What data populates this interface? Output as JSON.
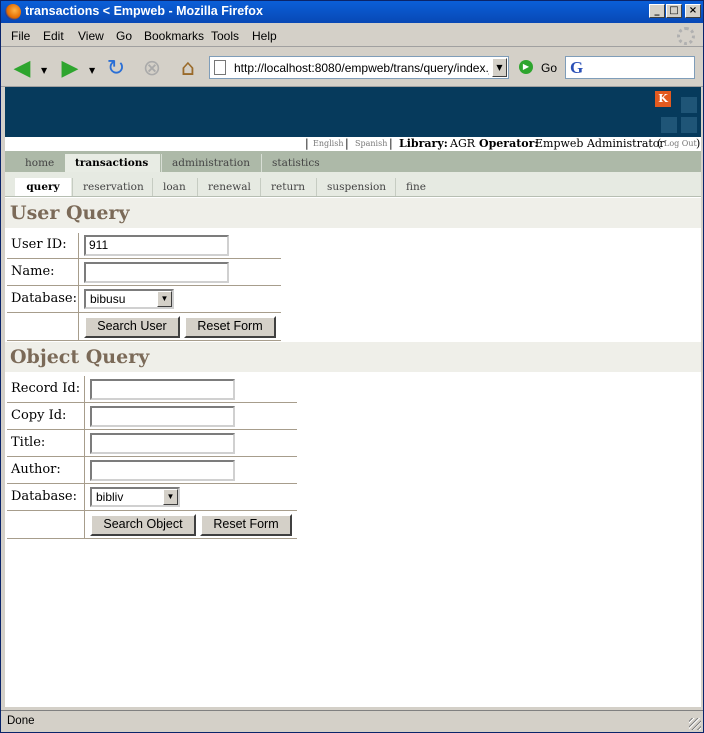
{
  "window": {
    "title": "transactions < Empweb - Mozilla Firefox"
  },
  "menu": {
    "items": [
      "File",
      "Edit",
      "View",
      "Go",
      "Bookmarks",
      "Tools",
      "Help"
    ]
  },
  "navbar": {
    "url": "http://localhost:8080/empweb/trans/query/index.jsp",
    "go_label": "Go"
  },
  "header": {
    "lang_english": "English",
    "lang_spanish": "Spanish",
    "library_label": "Library:",
    "library_value": "AGR",
    "operator_label": "Operator:",
    "operator_value": "Empweb Administrator",
    "logout": "Log Out",
    "logo_letter": "K"
  },
  "tabs": [
    "home",
    "transactions",
    "administration",
    "statistics"
  ],
  "subtabs": [
    "query",
    "reservation",
    "loan",
    "renewal",
    "return",
    "suspension",
    "fine"
  ],
  "user_query": {
    "title": "User Query",
    "userid_label": "User ID:",
    "userid_value": "911",
    "name_label": "Name:",
    "name_value": "",
    "database_label": "Database:",
    "database_value": "bibusu",
    "search_button": "Search User",
    "reset_button": "Reset Form"
  },
  "object_query": {
    "title": "Object Query",
    "recordid_label": "Record Id:",
    "recordid_value": "",
    "copyid_label": "Copy Id:",
    "copyid_value": "",
    "title_label": "Title:",
    "title_value": "",
    "author_label": "Author:",
    "author_value": "",
    "database_label": "Database:",
    "database_value": "bibliv",
    "search_button": "Search Object",
    "reset_button": "Reset Form"
  },
  "status": {
    "text": "Done"
  },
  "colors": {
    "banner": "#063a5c",
    "tab_bar": "#adb9a8",
    "section_title": "#7b6a58",
    "logo": "#e35a1f"
  }
}
